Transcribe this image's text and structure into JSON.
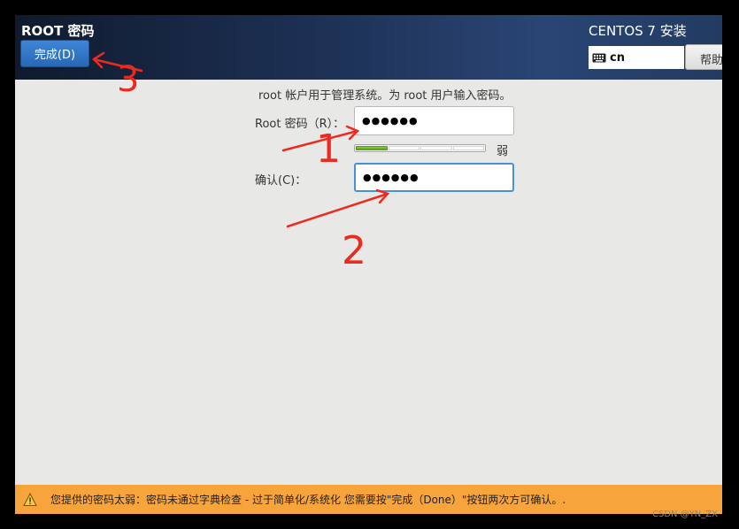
{
  "header": {
    "title": "ROOT 密码",
    "done_label": "完成(D)",
    "product": "CENTOS 7 安装",
    "keyboard_layout": "cn",
    "help_label": "帮助"
  },
  "form": {
    "description": "root 帐户用于管理系统。为 root 用户输入密码。",
    "root_password_label": "Root 密码（R）：",
    "root_password_masked": "●●●●●●",
    "confirm_label": "确认(C)：",
    "confirm_password_masked": "●●●●●●",
    "strength_text": "弱",
    "strength_level": 0.25
  },
  "warning": {
    "text": "您提供的密码太弱：密码未通过字典检查 - 过于简单化/系统化 您需要按\"完成（Done）\"按钮两次方可确认。."
  },
  "annotations": [
    "1",
    "2",
    "3"
  ],
  "watermark": "CSDN @YN_ZX",
  "colors": {
    "header_blue": "#1e3257",
    "button_blue": "#3478c6",
    "warning_orange": "#f7a43c",
    "strength_green": "#6db02d",
    "annotation_red": "#ee2a1e"
  }
}
